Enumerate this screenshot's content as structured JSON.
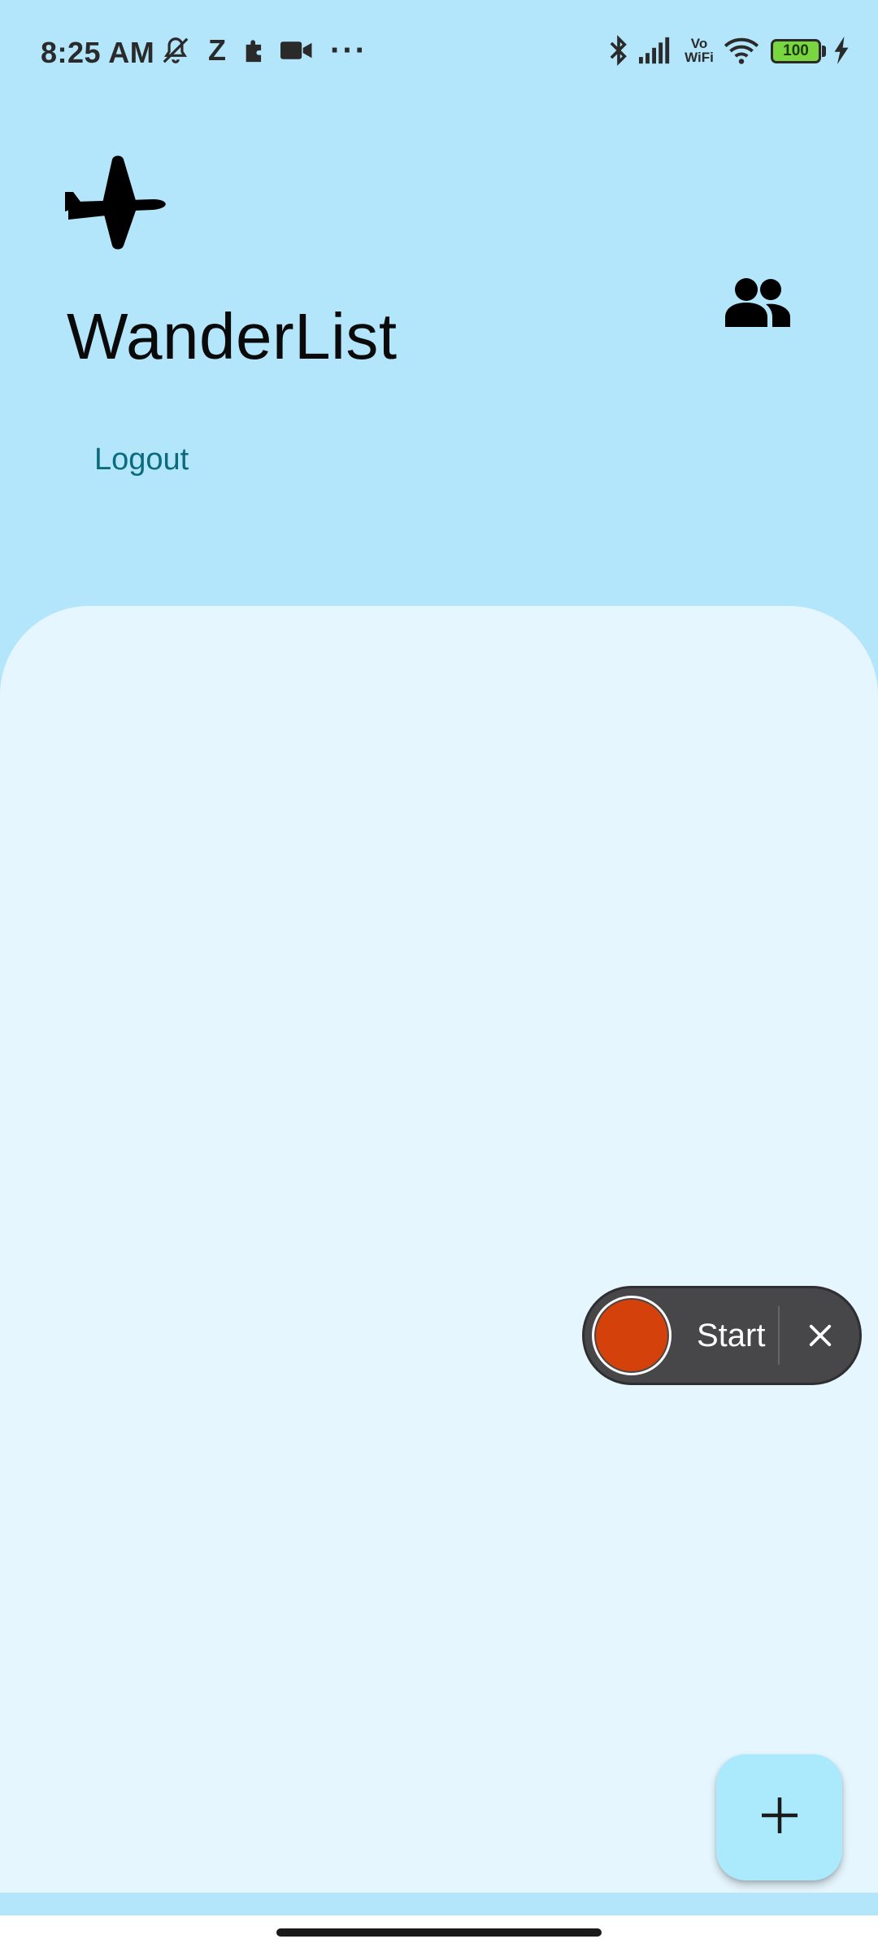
{
  "status_bar": {
    "time": "8:25 AM",
    "z_label": "Z",
    "more": "···",
    "vo_label": "Vo",
    "wifi_label": "WiFi",
    "battery": "100",
    "icons": [
      "mute-bell-icon",
      "z-app-icon",
      "puzzle-icon",
      "video-camera-icon",
      "more-dots-icon",
      "bluetooth-icon",
      "signal-icon",
      "vowifi-icon",
      "wifi-icon",
      "battery-icon",
      "charging-icon"
    ]
  },
  "header": {
    "logo_icon": "airplane-icon",
    "title": "WanderList",
    "people_icon": "people-icon",
    "logout_label": "Logout"
  },
  "recorder": {
    "start_label": "Start",
    "record_color": "#D5410A",
    "close_icon": "close-icon"
  },
  "fab": {
    "icon": "plus-icon"
  },
  "colors": {
    "header_bg": "#B3E5FB",
    "content_bg": "#E6F6FE",
    "fab_bg": "#ABE9FC",
    "link": "#0B6A7B"
  }
}
